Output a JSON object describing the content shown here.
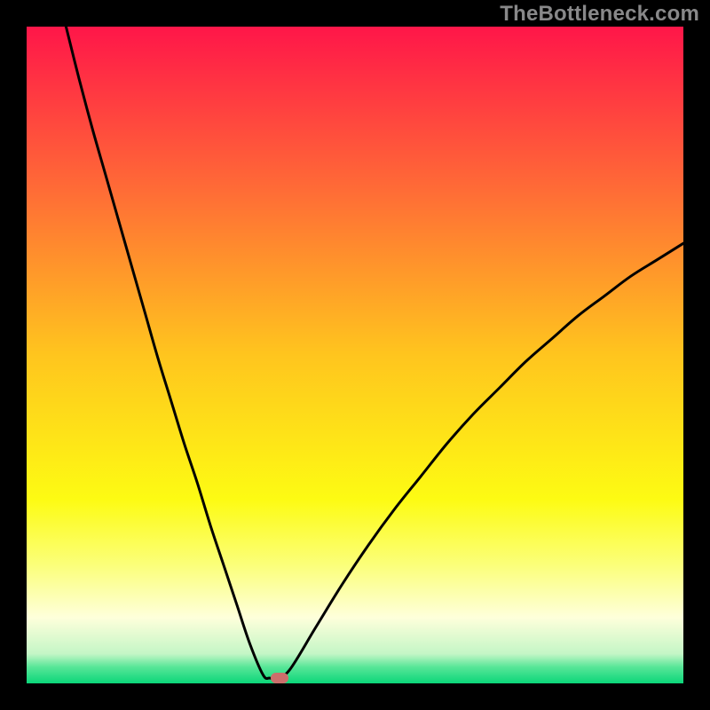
{
  "watermark": "TheBottleneck.com",
  "chart_data": {
    "type": "line",
    "title": "",
    "xlabel": "",
    "ylabel": "",
    "xlim": [
      0,
      100
    ],
    "ylim": [
      0,
      100
    ],
    "series": [
      {
        "name": "left-branch",
        "x": [
          6,
          8,
          10,
          12,
          14,
          16,
          18,
          20,
          22,
          24,
          26,
          28,
          30,
          32,
          34,
          36,
          37,
          38
        ],
        "y": [
          100,
          92,
          84.5,
          77.5,
          70.5,
          63.5,
          56.5,
          49.5,
          43,
          36.5,
          30.5,
          24,
          18,
          12,
          6,
          1.3,
          0.8,
          0.8
        ]
      },
      {
        "name": "right-branch",
        "x": [
          38,
          40,
          44,
          48,
          52,
          56,
          60,
          64,
          68,
          72,
          76,
          80,
          84,
          88,
          92,
          96,
          100
        ],
        "y": [
          0.8,
          2,
          8.5,
          15,
          21,
          26.5,
          31.5,
          36.5,
          41,
          45,
          49,
          52.5,
          56,
          59,
          62,
          64.5,
          67
        ]
      }
    ],
    "marker": {
      "x": 38.5,
      "y": 0.8,
      "color": "#cc6e6b"
    },
    "background_gradient": {
      "stops": [
        {
          "offset": 0.0,
          "color": "#ff1649"
        },
        {
          "offset": 0.25,
          "color": "#ff6c36"
        },
        {
          "offset": 0.5,
          "color": "#ffc51e"
        },
        {
          "offset": 0.72,
          "color": "#fdfb13"
        },
        {
          "offset": 0.82,
          "color": "#fbff7a"
        },
        {
          "offset": 0.9,
          "color": "#feffdb"
        },
        {
          "offset": 0.955,
          "color": "#c4f6c6"
        },
        {
          "offset": 0.975,
          "color": "#58e698"
        },
        {
          "offset": 1.0,
          "color": "#0bd679"
        }
      ]
    }
  }
}
